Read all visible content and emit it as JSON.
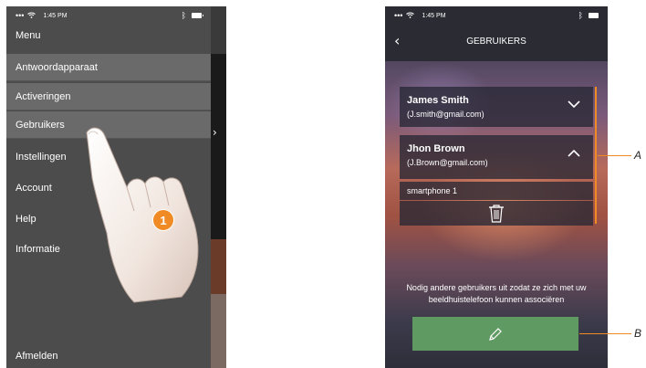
{
  "status_bar": {
    "time": "1:45 PM"
  },
  "left_screen": {
    "menu_title": "Menu",
    "items": [
      {
        "label": "Antwoordapparaat",
        "highlighted": true
      },
      {
        "label": "Activeringen",
        "highlighted": true
      },
      {
        "label": "Gebruikers",
        "highlighted": true
      },
      {
        "label": "Instellingen",
        "highlighted": false
      },
      {
        "label": "Account",
        "highlighted": false
      },
      {
        "label": "Help",
        "highlighted": false
      },
      {
        "label": "Informatie",
        "highlighted": false
      }
    ],
    "logout": "Afmelden",
    "step_badge": "1"
  },
  "right_screen": {
    "title": "GEBRUIKERS",
    "users": [
      {
        "name": "James Smith",
        "email": "(J.smith@gmail.com)",
        "expanded": false
      },
      {
        "name": "Jhon Brown",
        "email": "(J.Brown@gmail.com)",
        "expanded": true
      }
    ],
    "device": "smartphone 1",
    "invite_text_line1": "Nodig andere gebruikers uit zodat ze zich met uw",
    "invite_text_line2": "beeldhuistelefoon kunnen associëren"
  },
  "callouts": {
    "a": "A",
    "b": "B"
  },
  "colors": {
    "accent": "#f08a24",
    "edit_button": "#5f9a63",
    "menu_bg": "#4c4c4c"
  }
}
